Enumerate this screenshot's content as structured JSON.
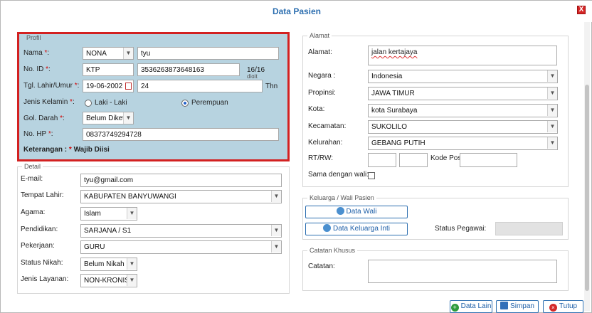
{
  "window": {
    "title": "Data Pasien",
    "close_label": "X"
  },
  "profil": {
    "legend": "Profil",
    "nama_label": "Nama",
    "nama_prefix": "NONA",
    "nama_value": "tyu",
    "noid_label": "No. ID",
    "noid_type": "KTP",
    "noid_value": "3536263873648163",
    "noid_count": "16/16",
    "noid_count_unit": "digit",
    "tgl_label": "Tgl. Lahir/Umur",
    "tgl_value": "19-06-2002",
    "umur_value": "24",
    "umur_unit": "Thn",
    "jk_label": "Jenis Kelamin",
    "jk_options": [
      "Laki - Laki",
      "Perempuan"
    ],
    "jk_selected": "Perempuan",
    "gol_label": "Gol. Darah",
    "gol_value": "Belum Diketahui",
    "hp_label": "No. HP",
    "hp_value": "08373749294728",
    "keterangan_prefix": "Keterangan : ",
    "keterangan_suffix": " Wajib Diisi",
    "req_mark": "*"
  },
  "detail": {
    "legend": "Detail",
    "email_label": "E-mail:",
    "email_value": "tyu@gmail.com",
    "tempat_label": "Tempat Lahir:",
    "tempat_value": "KABUPATEN BANYUWANGI",
    "agama_label": "Agama:",
    "agama_value": "Islam",
    "pendidikan_label": "Pendidikan:",
    "pendidikan_value": "SARJANA / S1",
    "pekerjaan_label": "Pekerjaan:",
    "pekerjaan_value": "GURU",
    "nikah_label": "Status Nikah:",
    "nikah_value": "Belum Nikah",
    "layanan_label": "Jenis Layanan:",
    "layanan_value": "NON-KRONIS"
  },
  "alamat": {
    "legend": "Alamat",
    "alamat_label": "Alamat:",
    "alamat_value": "jalan kertajaya",
    "negara_label": "Negara :",
    "negara_value": "Indonesia",
    "propinsi_label": "Propinsi:",
    "propinsi_value": "JAWA TIMUR",
    "kota_label": "Kota:",
    "kota_value": "kota Surabaya",
    "kecamatan_label": "Kecamatan:",
    "kecamatan_value": "SUKOLILO",
    "kelurahan_label": "Kelurahan:",
    "kelurahan_value": "GEBANG PUTIH",
    "rtrw_label": "RT/RW:",
    "kodepos_label": "Kode Pos",
    "sama_label": "Sama dengan wali:"
  },
  "keluarga": {
    "legend": "Keluarga / Wali Pasien",
    "data_wali": "Data Wali",
    "data_keluarga": "Data Keluarga Inti",
    "status_pegawai_label": "Status Pegawai:"
  },
  "catatan": {
    "legend": "Catatan Khusus",
    "catatan_label": "Catatan:"
  },
  "footer": {
    "data_lain": "Data Lain",
    "simpan": "Simpan",
    "tutup": "Tutup"
  }
}
